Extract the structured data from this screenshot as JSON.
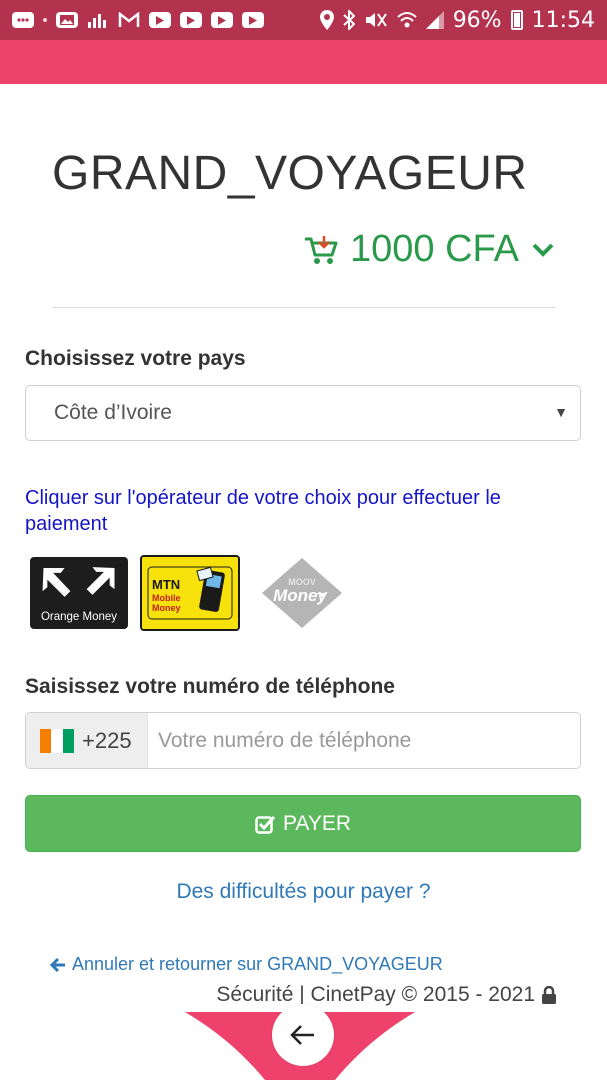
{
  "status_bar": {
    "battery": "96%",
    "time": "11:54"
  },
  "merchant": {
    "name": "GRAND_VOYAGEUR"
  },
  "amount": {
    "text": "1000 CFA"
  },
  "country": {
    "label": "Choisissez votre pays",
    "selected": "Côte d’Ivoire"
  },
  "operators": {
    "hint": "Cliquer sur l'opérateur de votre choix pour effectuer le paiement",
    "items": [
      {
        "name": "Orange Money",
        "label": "Orange Money"
      },
      {
        "name": "MTN Mobile Money",
        "label_top": "MTN",
        "label_mid": "Mobile",
        "label_bot": "Money"
      },
      {
        "name": "Moov Money",
        "label_top": "MOOV",
        "label_bot": "Money"
      }
    ]
  },
  "phone": {
    "label": "Saisissez votre numéro de téléphone",
    "prefix": "+225",
    "placeholder": "Votre numéro de téléphone",
    "value": ""
  },
  "pay_button": {
    "label": "PAYER"
  },
  "help_link": {
    "label": "Des difficultés pour payer ?"
  },
  "cancel_link": {
    "label": "Annuler et retourner sur GRAND_VOYAGEUR"
  },
  "footer": {
    "text": "Sécurité |  CinetPay © 2015 - 2021"
  },
  "colors": {
    "status_bar": "#b3334f",
    "accent": "#ee426c",
    "amount_green": "#2a9a4a",
    "pay_green": "#5cb85c",
    "link_blue": "#3079b8",
    "hint_blue": "#1515c8"
  },
  "icons": [
    "cart-icon",
    "chevron-down-icon",
    "check-square-icon",
    "arrow-left-icon",
    "lock-icon",
    "back-arrow-icon"
  ]
}
